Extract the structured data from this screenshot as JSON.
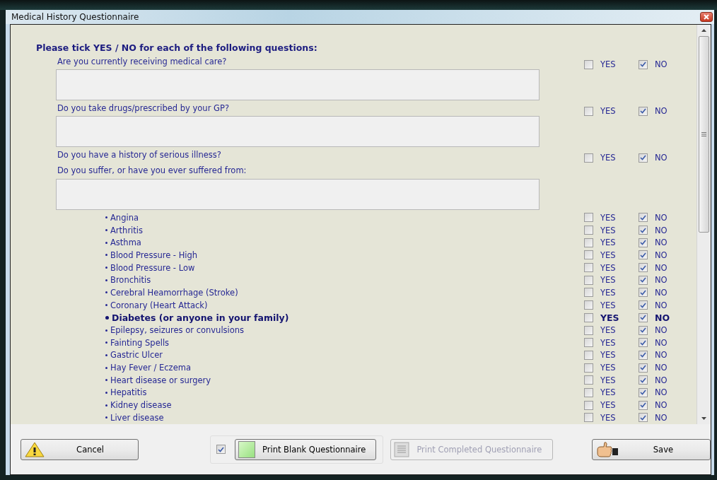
{
  "window": {
    "title": "Medical History Questionnaire"
  },
  "heading": "Please tick YES / NO for each of the following questions:",
  "items": [
    {
      "kind": "question",
      "text": "Are you currently receiving medical care?",
      "yes_label": "YES",
      "yes_checked": false,
      "no_label": "NO",
      "no_checked": true
    },
    {
      "kind": "notes"
    },
    {
      "kind": "question",
      "text": "Do you take drugs/prescribed by your GP?",
      "yes_label": "YES",
      "yes_checked": false,
      "no_label": "NO",
      "no_checked": true
    },
    {
      "kind": "notes"
    },
    {
      "kind": "question",
      "text": "Do you have a history of serious illness?",
      "yes_label": "YES",
      "yes_checked": false,
      "no_label": "NO",
      "no_checked": true
    },
    {
      "kind": "prompt",
      "text": "Do you suffer, or have you ever suffered from:"
    },
    {
      "kind": "notes"
    },
    {
      "kind": "condition",
      "text": "Angina",
      "emphasis": false,
      "yes_label": "YES",
      "yes_checked": false,
      "no_label": "NO",
      "no_checked": true
    },
    {
      "kind": "condition",
      "text": "Arthritis",
      "emphasis": false,
      "yes_label": "YES",
      "yes_checked": false,
      "no_label": "NO",
      "no_checked": true
    },
    {
      "kind": "condition",
      "text": "Asthma",
      "emphasis": false,
      "yes_label": "YES",
      "yes_checked": false,
      "no_label": "NO",
      "no_checked": true
    },
    {
      "kind": "condition",
      "text": "Blood Pressure - High",
      "emphasis": false,
      "yes_label": "YES",
      "yes_checked": false,
      "no_label": "NO",
      "no_checked": true
    },
    {
      "kind": "condition",
      "text": "Blood Pressure - Low",
      "emphasis": false,
      "yes_label": "YES",
      "yes_checked": false,
      "no_label": "NO",
      "no_checked": true
    },
    {
      "kind": "condition",
      "text": "Bronchitis",
      "emphasis": false,
      "yes_label": "YES",
      "yes_checked": false,
      "no_label": "NO",
      "no_checked": true
    },
    {
      "kind": "condition",
      "text": "Cerebral Heamorrhage (Stroke)",
      "emphasis": false,
      "yes_label": "YES",
      "yes_checked": false,
      "no_label": "NO",
      "no_checked": true
    },
    {
      "kind": "condition",
      "text": "Coronary (Heart Attack)",
      "emphasis": false,
      "yes_label": "YES",
      "yes_checked": false,
      "no_label": "NO",
      "no_checked": true
    },
    {
      "kind": "condition",
      "text": "Diabetes (or anyone in your family)",
      "emphasis": true,
      "yes_label": "YES",
      "yes_checked": false,
      "no_label": "NO",
      "no_checked": true
    },
    {
      "kind": "condition",
      "text": "Epilepsy, seizures or convulsions",
      "emphasis": false,
      "yes_label": "YES",
      "yes_checked": false,
      "no_label": "NO",
      "no_checked": true
    },
    {
      "kind": "condition",
      "text": "Fainting Spells",
      "emphasis": false,
      "yes_label": "YES",
      "yes_checked": false,
      "no_label": "NO",
      "no_checked": true
    },
    {
      "kind": "condition",
      "text": "Gastric Ulcer",
      "emphasis": false,
      "yes_label": "YES",
      "yes_checked": false,
      "no_label": "NO",
      "no_checked": true
    },
    {
      "kind": "condition",
      "text": "Hay Fever / Eczema",
      "emphasis": false,
      "yes_label": "YES",
      "yes_checked": false,
      "no_label": "NO",
      "no_checked": true
    },
    {
      "kind": "condition",
      "text": "Heart disease or surgery",
      "emphasis": false,
      "yes_label": "YES",
      "yes_checked": false,
      "no_label": "NO",
      "no_checked": true
    },
    {
      "kind": "condition",
      "text": "Hepatitis",
      "emphasis": false,
      "yes_label": "YES",
      "yes_checked": false,
      "no_label": "NO",
      "no_checked": true
    },
    {
      "kind": "condition",
      "text": "Kidney disease",
      "emphasis": false,
      "yes_label": "YES",
      "yes_checked": false,
      "no_label": "NO",
      "no_checked": true
    },
    {
      "kind": "condition",
      "text": "Liver disease",
      "emphasis": false,
      "yes_label": "YES",
      "yes_checked": false,
      "no_label": "NO",
      "no_checked": true
    }
  ],
  "footer": {
    "cancel": {
      "label": "Cancel"
    },
    "print_blank": {
      "checked": true,
      "label": "Print Blank Questionnaire"
    },
    "print_completed": {
      "label": "Print Completed Questionnaire",
      "disabled": true
    },
    "save": {
      "label": "Save"
    }
  }
}
